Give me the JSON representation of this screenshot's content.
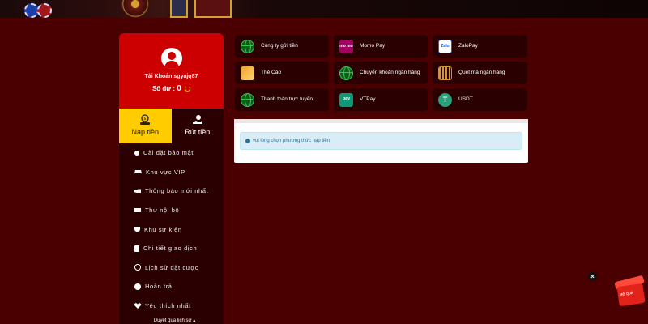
{
  "header": {
    "banner_icons": [
      "casino-chip-icon",
      "roulette-wheel-icon",
      "slot-machine-icon"
    ]
  },
  "profile": {
    "account_label": "Tài Khoản sgyajq87",
    "balance_label": "Số dư :",
    "balance_value": "0"
  },
  "actions": {
    "deposit_label": "Nạp tiền",
    "withdraw_label": "Rút tiền"
  },
  "menu": {
    "items": [
      {
        "label": "Cài đặt bảo mật",
        "icon": "user-lock-icon"
      },
      {
        "label": "Khu vực VIP",
        "icon": "crown-icon"
      },
      {
        "label": "Thông báo mới nhất",
        "icon": "megaphone-icon"
      },
      {
        "label": "Thư nội bộ",
        "icon": "envelope-icon"
      },
      {
        "label": "Khu sự kiện",
        "icon": "trophy-icon"
      },
      {
        "label": "Chi tiết giao dịch",
        "icon": "clipboard-icon"
      },
      {
        "label": "Lịch sử đặt cược",
        "icon": "history-icon"
      },
      {
        "label": "Hoàn trả",
        "icon": "coin-icon"
      },
      {
        "label": "Yêu thích nhất",
        "icon": "heart-icon"
      }
    ],
    "browse_history": "Duyệt qua lịch sử"
  },
  "payment_methods": [
    {
      "label": "Công ty gửi tiền",
      "icon": "globe-icon"
    },
    {
      "label": "Momo Pay",
      "icon": "momo-icon",
      "icon_text": "mo mo"
    },
    {
      "label": "ZaloPay",
      "icon": "zalopay-icon",
      "icon_text": "Zalo"
    },
    {
      "label": "Thẻ Cào",
      "icon": "scratch-card-icon"
    },
    {
      "label": "Chuyển khoản ngân hàng",
      "icon": "globe-icon"
    },
    {
      "label": "Quét mã ngân hàng",
      "icon": "qr-code-icon"
    },
    {
      "label": "Thanh toán trực tuyến",
      "icon": "globe-icon"
    },
    {
      "label": "VTPay",
      "icon": "vtpay-icon",
      "icon_text": "pay"
    },
    {
      "label": "USDT",
      "icon": "usdt-icon",
      "icon_text": "T"
    }
  ],
  "notice": {
    "text": "vui lòng chọn phương thức nạp tiền"
  },
  "widget": {
    "close": "×",
    "gift_text": "MỞ QUÀ"
  },
  "colors": {
    "background": "#4a0000",
    "profile_red": "#cc0000",
    "deposit_yellow": "#ffcc00",
    "panel_dark": "#2a0000",
    "notice_bg": "#d9edf7"
  }
}
